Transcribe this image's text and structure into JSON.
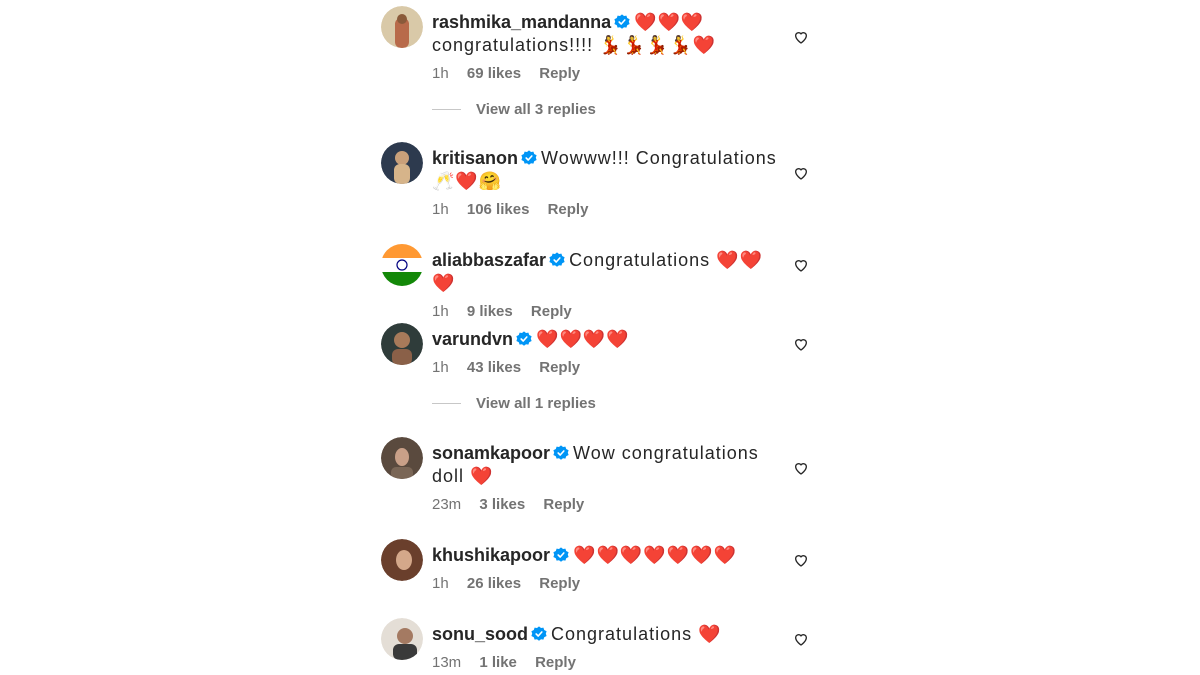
{
  "comments": [
    {
      "user": "rashmika_mandanna",
      "text": "❤️❤️❤️ congratulations!!!! 💃💃💃💃❤️",
      "time": "1h",
      "likes": "69 likes",
      "reply": "Reply",
      "avatar_color": "#b8956a"
    },
    {
      "user": "kritisanon",
      "text": "Wowww!!! Congratulations 🥂❤️🤗",
      "time": "1h",
      "likes": "106 likes",
      "reply": "Reply",
      "avatar_color": "#4a5a6e"
    },
    {
      "user": "aliabbaszafar",
      "text": "Congratulations ❤️❤️❤️",
      "time": "1h",
      "likes": "9 likes",
      "reply": "Reply",
      "avatar_color": "#ff9933"
    },
    {
      "user": "varundvn",
      "text": "❤️❤️❤️❤️",
      "time": "1h",
      "likes": "43 likes",
      "reply": "Reply",
      "avatar_color": "#3a4a48"
    },
    {
      "user": "sonamkapoor",
      "text": "Wow congratulations doll ❤️",
      "time": "23m",
      "likes": "3 likes",
      "reply": "Reply",
      "avatar_color": "#6b5a4c"
    },
    {
      "user": "khushikapoor",
      "text": "❤️❤️❤️❤️❤️❤️❤️",
      "time": "1h",
      "likes": "26 likes",
      "reply": "Reply",
      "avatar_color": "#7a4f3a"
    },
    {
      "user": "sonu_sood",
      "text": "Congratulations ❤️",
      "time": "13m",
      "likes": "1 like",
      "reply": "Reply",
      "avatar_color": "#c9c2b8"
    }
  ],
  "view_replies": [
    "View all 3 replies",
    "View all 1 replies"
  ],
  "colors": {
    "verified": "#0095f6",
    "meta": "#737373",
    "text": "#262626"
  }
}
